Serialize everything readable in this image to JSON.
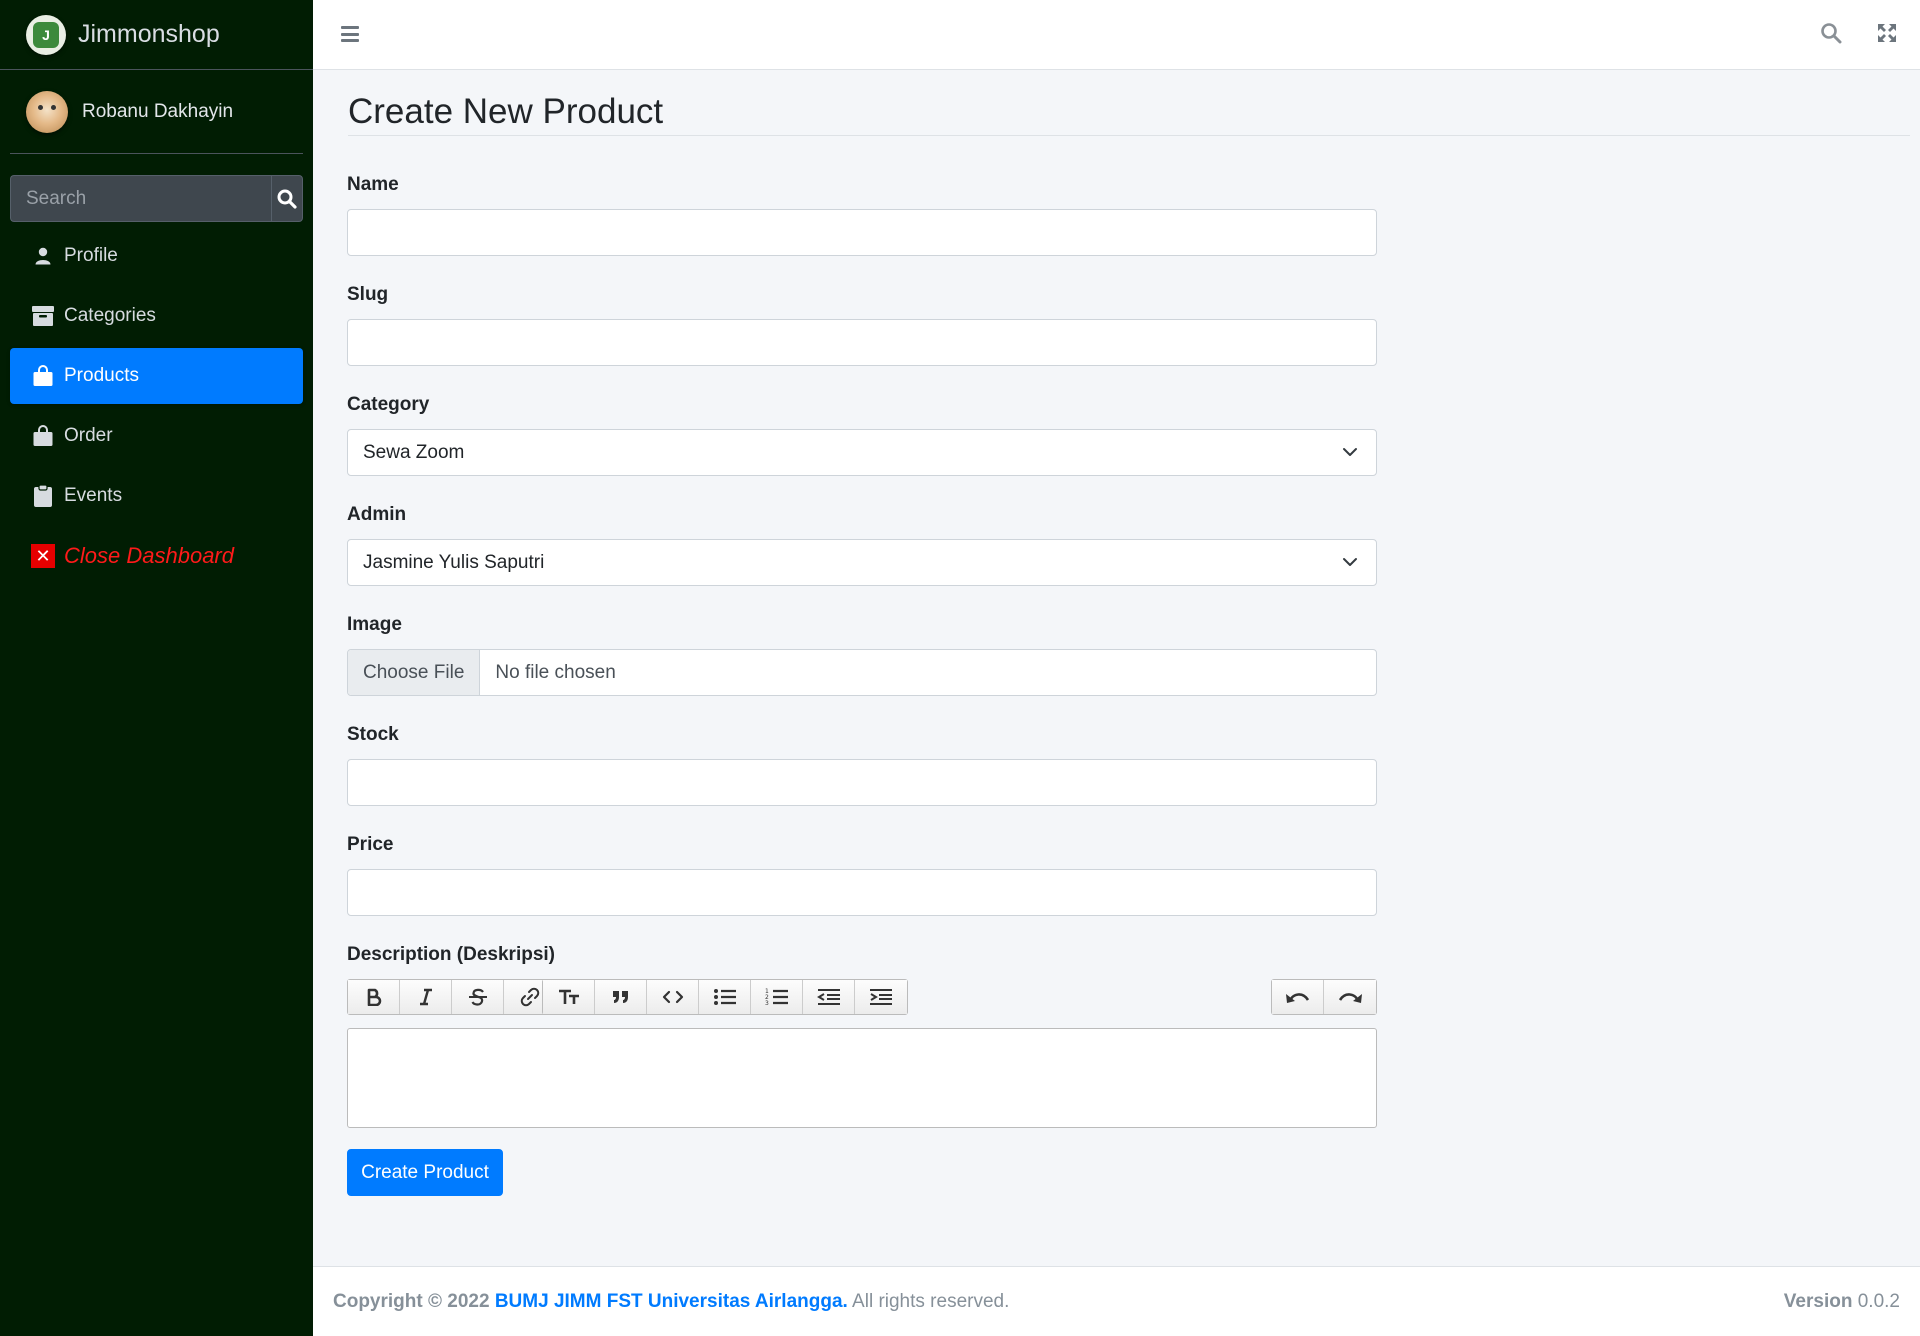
{
  "brand": {
    "name": "Jimmonshop",
    "logo_letter": "J"
  },
  "user": {
    "name": "Robanu Dakhayin"
  },
  "sidebar": {
    "search_placeholder": "Search",
    "items": [
      {
        "label": "Profile",
        "icon": "user-icon"
      },
      {
        "label": "Categories",
        "icon": "box-icon"
      },
      {
        "label": "Products",
        "icon": "shopping-bag-icon",
        "active": true
      },
      {
        "label": "Order",
        "icon": "shopping-bag-icon"
      },
      {
        "label": "Events",
        "icon": "clipboard-icon"
      },
      {
        "label": "Close Dashboard",
        "icon": "close-icon"
      }
    ]
  },
  "page": {
    "title": "Create New Product"
  },
  "form": {
    "name_label": "Name",
    "name_value": "",
    "slug_label": "Slug",
    "slug_value": "",
    "category_label": "Category",
    "category_value": "Sewa Zoom",
    "admin_label": "Admin",
    "admin_value": "Jasmine Yulis Saputri",
    "image_label": "Image",
    "image_button": "Choose File",
    "image_status": "No file chosen",
    "stock_label": "Stock",
    "stock_value": "",
    "price_label": "Price",
    "price_value": "",
    "description_label": "Description (Deskripsi)",
    "submit_label": "Create Product"
  },
  "footer": {
    "copyright": "Copyright © 2022",
    "org": "BUMJ JIMM FST Universitas Airlangga.",
    "rights": "All rights reserved.",
    "version_label": "Version",
    "version_value": "0.0.2"
  },
  "colors": {
    "sidebar_bg": "#011d03",
    "accent": "#007bff",
    "close_red": "#ff1a1a"
  }
}
